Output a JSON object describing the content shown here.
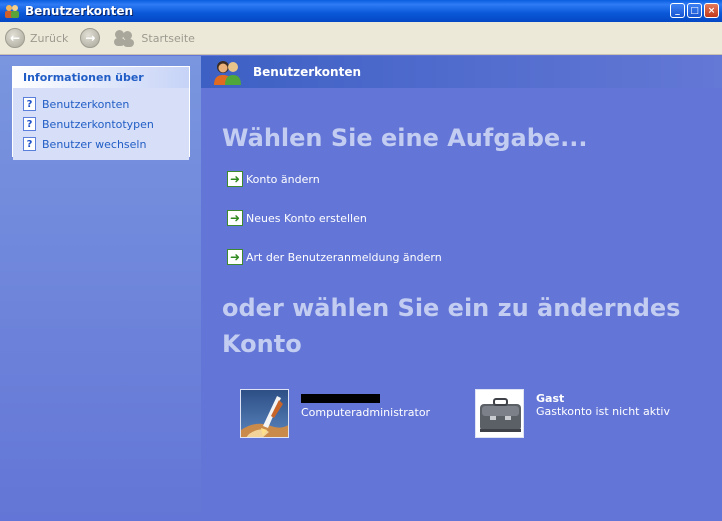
{
  "window": {
    "title": "Benutzerkonten",
    "minimize_label": "_",
    "maximize_label": "□",
    "close_label": "×"
  },
  "toolbar": {
    "back_label": "Zurück",
    "back_glyph": "←",
    "forward_glyph": "→",
    "home_label": "Startseite"
  },
  "sidebar": {
    "header": "Informationen über",
    "help_glyph": "?",
    "items": [
      {
        "label": "Benutzerkonten"
      },
      {
        "label": "Benutzerkontotypen"
      },
      {
        "label": "Benutzer wechseln"
      }
    ]
  },
  "main": {
    "banner_title": "Benutzerkonten",
    "heading_tasks": "Wählen Sie eine Aufgabe...",
    "arrow_glyph": "➜",
    "tasks": [
      {
        "label": "Konto ändern"
      },
      {
        "label": "Neues Konto erstellen"
      },
      {
        "label": "Art der Benutzeranmeldung ändern"
      }
    ],
    "heading_accounts": "oder wählen Sie ein zu änderndes Konto",
    "accounts": [
      {
        "name": "",
        "type": "Computeradministrator",
        "picture": "space-shuttle-icon"
      },
      {
        "name": "Gast",
        "type": "Gastkonto ist nicht aktiv",
        "picture": "briefcase-icon"
      }
    ]
  },
  "colors": {
    "titlebar": "#0a58d8",
    "main_background": "#6375d6",
    "heading": "#c3cdf1",
    "link": "#215dc6"
  }
}
